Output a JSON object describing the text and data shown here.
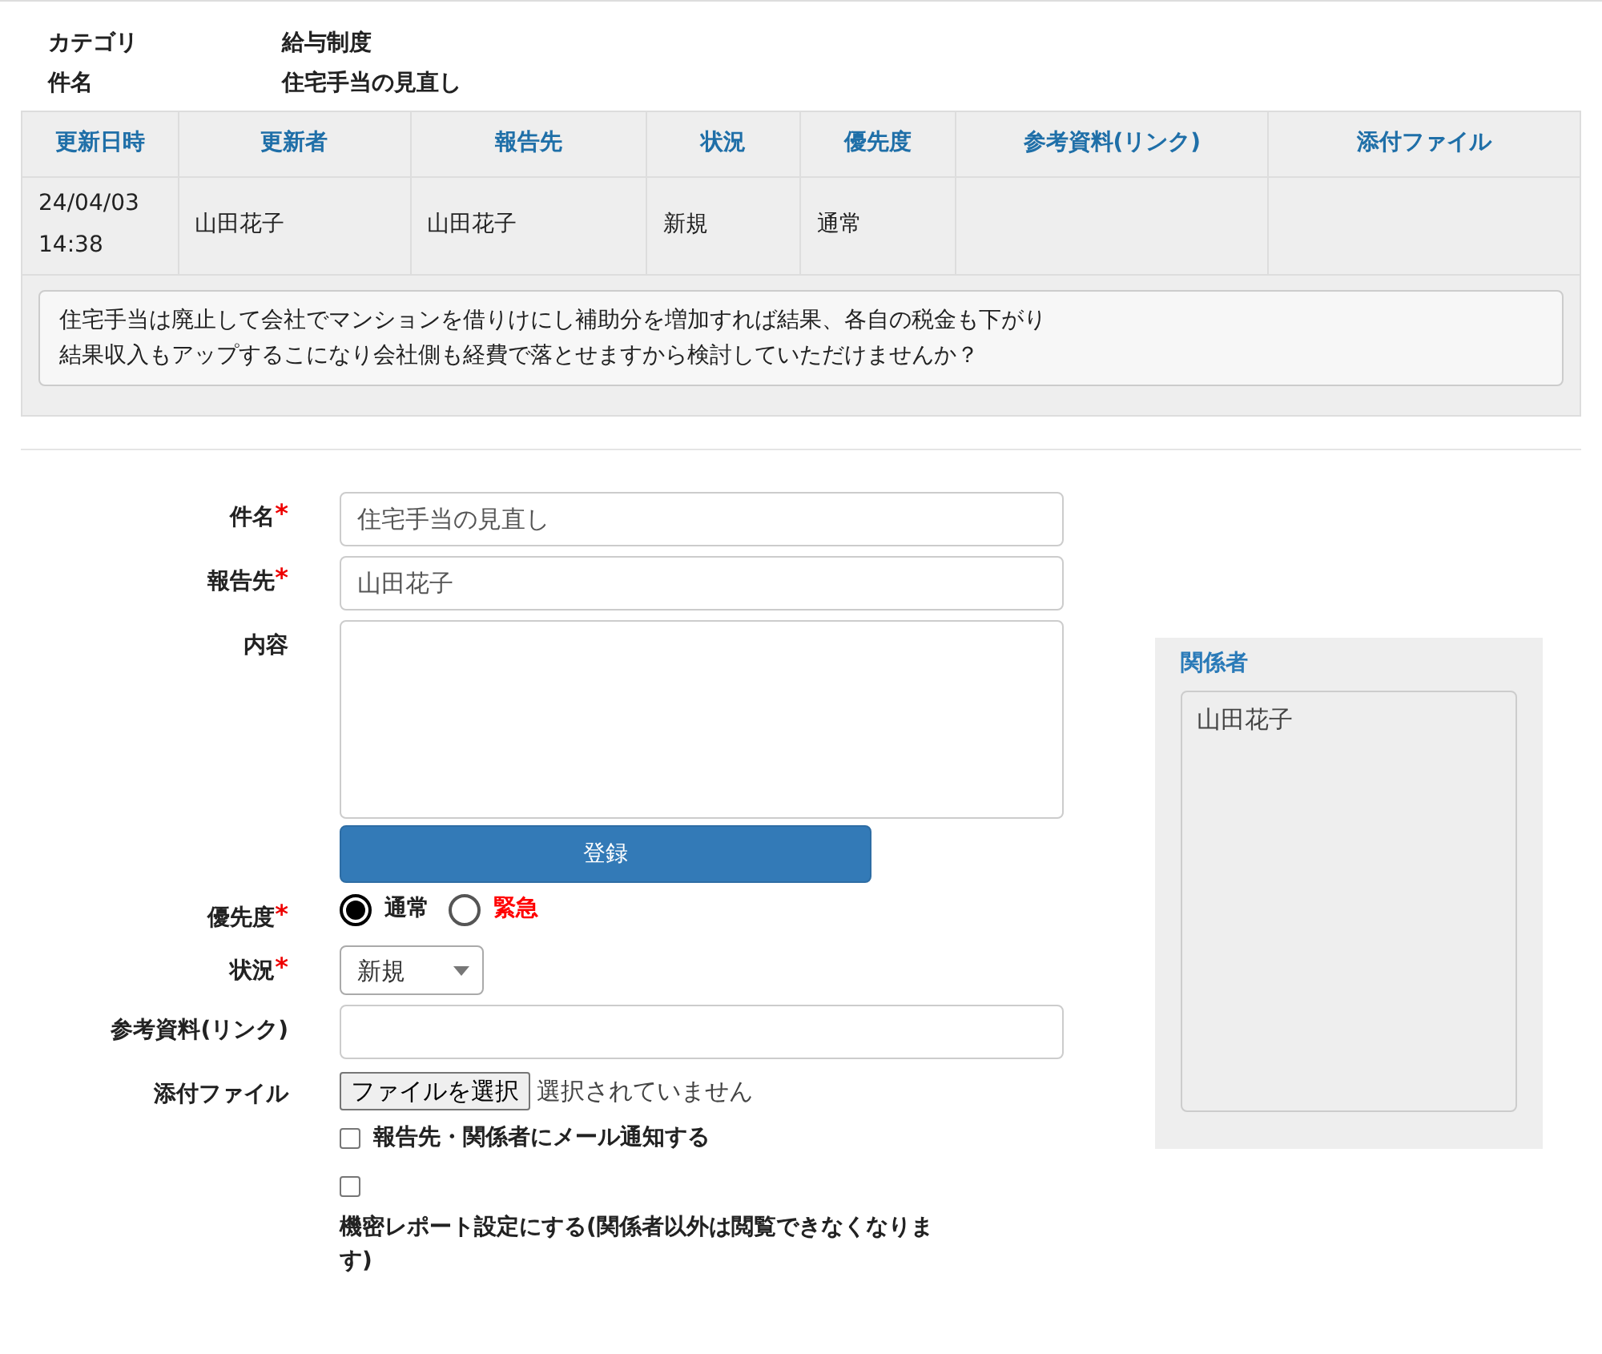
{
  "summary": [
    {
      "label": "カテゴリ",
      "value": "給与制度"
    },
    {
      "label": "件名",
      "value": "住宅手当の見直し"
    }
  ],
  "history": {
    "columns": [
      "更新日時",
      "更新者",
      "報告先",
      "状況",
      "優先度",
      "参考資料(リンク)",
      "添付ファイル"
    ],
    "rows": [
      {
        "cells": [
          "24/04/03 14:38",
          "山田花子",
          "山田花子",
          "新規",
          "通常",
          "",
          ""
        ]
      }
    ],
    "message_lines": [
      "住宅手当は廃止して会社でマンションを借りけにし補助分を増加すれば結果、各自の税金も下がり",
      "結果収入もアップするこになり会社側も経費で落とせますから検討していただけませんか？"
    ]
  },
  "form": {
    "fields": [
      {
        "kind": "text",
        "label": "件名",
        "required_mark": "*",
        "value": "住宅手当の見直し"
      },
      {
        "kind": "text",
        "label": "報告先",
        "required_mark": "*",
        "value": "山田花子"
      },
      {
        "kind": "textarea",
        "label": "内容"
      },
      {
        "kind": "button",
        "text": "登録"
      },
      {
        "kind": "radio",
        "label": "優先度",
        "required_mark": "*",
        "options": [
          {
            "label": "通常",
            "selected": true,
            "color": "#222222"
          },
          {
            "label": "緊急",
            "selected": false,
            "color": "#ff0000"
          }
        ]
      },
      {
        "kind": "select",
        "label": "状況",
        "required_mark": "*",
        "value": "新規"
      },
      {
        "kind": "text",
        "label": "参考資料(リンク)"
      },
      {
        "kind": "file",
        "label": "添付ファイル",
        "button": "ファイルを選択",
        "status": "選択されていません"
      },
      {
        "kind": "checkbox",
        "text": "報告先・関係者にメール通知する",
        "checked": false
      },
      {
        "kind": "checkbox-below",
        "text": "機密レポート設定にする(関係者以外は閲覧できなくなります)",
        "checked": false
      }
    ]
  },
  "related": {
    "title": "関係者",
    "members": [
      "山田花子"
    ]
  }
}
